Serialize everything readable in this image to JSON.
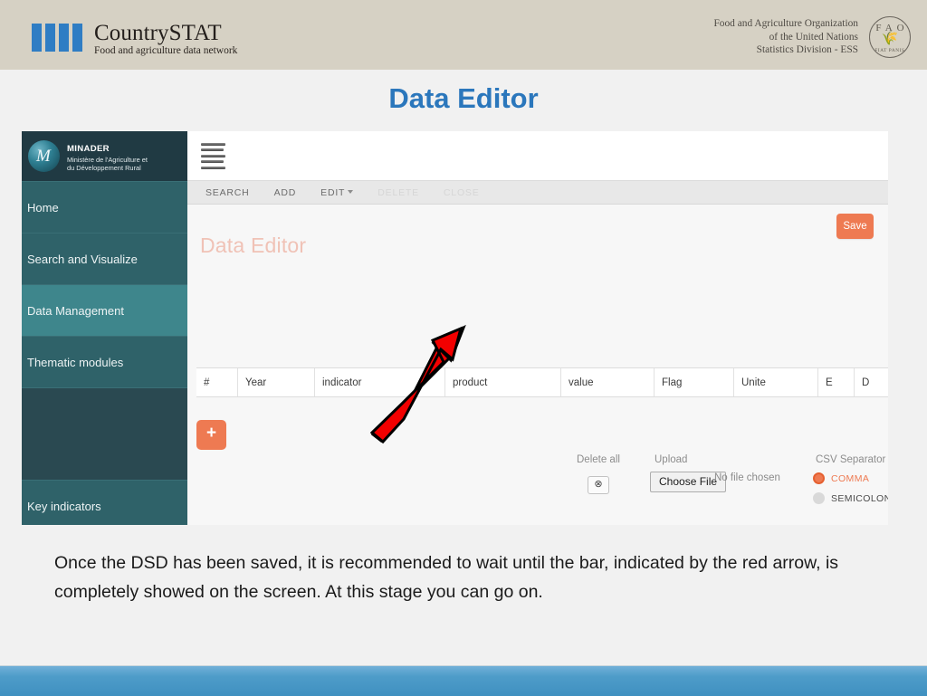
{
  "brand": {
    "countrystat_title": "CountrySTAT",
    "countrystat_tagline": "Food and agriculture data network",
    "fao_line1": "Food and Agriculture Organization",
    "fao_line2": "of the United Nations",
    "fao_line3": "Statistics Division - ESS",
    "fao_emblem_letters": "FAO",
    "fao_emblem_motto": "FIAT PANIS"
  },
  "slide": {
    "title": "Data Editor",
    "title_color": "#2b77bc",
    "caption": "Once the DSD has been saved, it is recommended to wait until the bar, indicated by the red arrow, is completely showed on the screen. At this stage you can go on."
  },
  "app": {
    "sidebar": {
      "org_name": "MINADER",
      "org_sub_line1": "Ministère de l'Agriculture et",
      "org_sub_line2": "du Développement Rural",
      "items": [
        {
          "label": "Home",
          "active": false
        },
        {
          "label": "Search and Visualize",
          "active": false
        },
        {
          "label": "Data Management",
          "active": true
        },
        {
          "label": "Thematic modules",
          "active": false
        }
      ],
      "bottom_item": {
        "label": "Key indicators"
      },
      "active_color": "#3e868c",
      "base_color": "#2f6269"
    },
    "menubar": {
      "items": [
        {
          "label": "SEARCH",
          "disabled": false,
          "has_caret": false
        },
        {
          "label": "ADD",
          "disabled": false,
          "has_caret": false
        },
        {
          "label": "EDIT",
          "disabled": false,
          "has_caret": true
        },
        {
          "label": "DELETE",
          "disabled": true,
          "has_caret": false
        },
        {
          "label": "CLOSE",
          "disabled": true,
          "has_caret": false
        }
      ]
    },
    "content": {
      "heading": "Data Editor",
      "save_label": "Save",
      "add_row_label": "+",
      "accent_color": "#ee7a52",
      "table_columns": [
        "#",
        "Year",
        "indicator",
        "product",
        "value",
        "Flag",
        "Unite",
        "E",
        "D"
      ],
      "delete_all_label": "Delete all",
      "delete_all_glyph": "⊗",
      "upload_label": "Upload",
      "choose_file_label": "Choose File",
      "no_file_label": "No file chosen",
      "csv_separator_label": "CSV Separator",
      "csv_options": [
        {
          "label": "COMMA",
          "selected": true
        },
        {
          "label": "SEMICOLON",
          "selected": false
        }
      ]
    }
  },
  "annotation": {
    "arrow_color": "#f20000",
    "arrow_outline": "#000000"
  }
}
